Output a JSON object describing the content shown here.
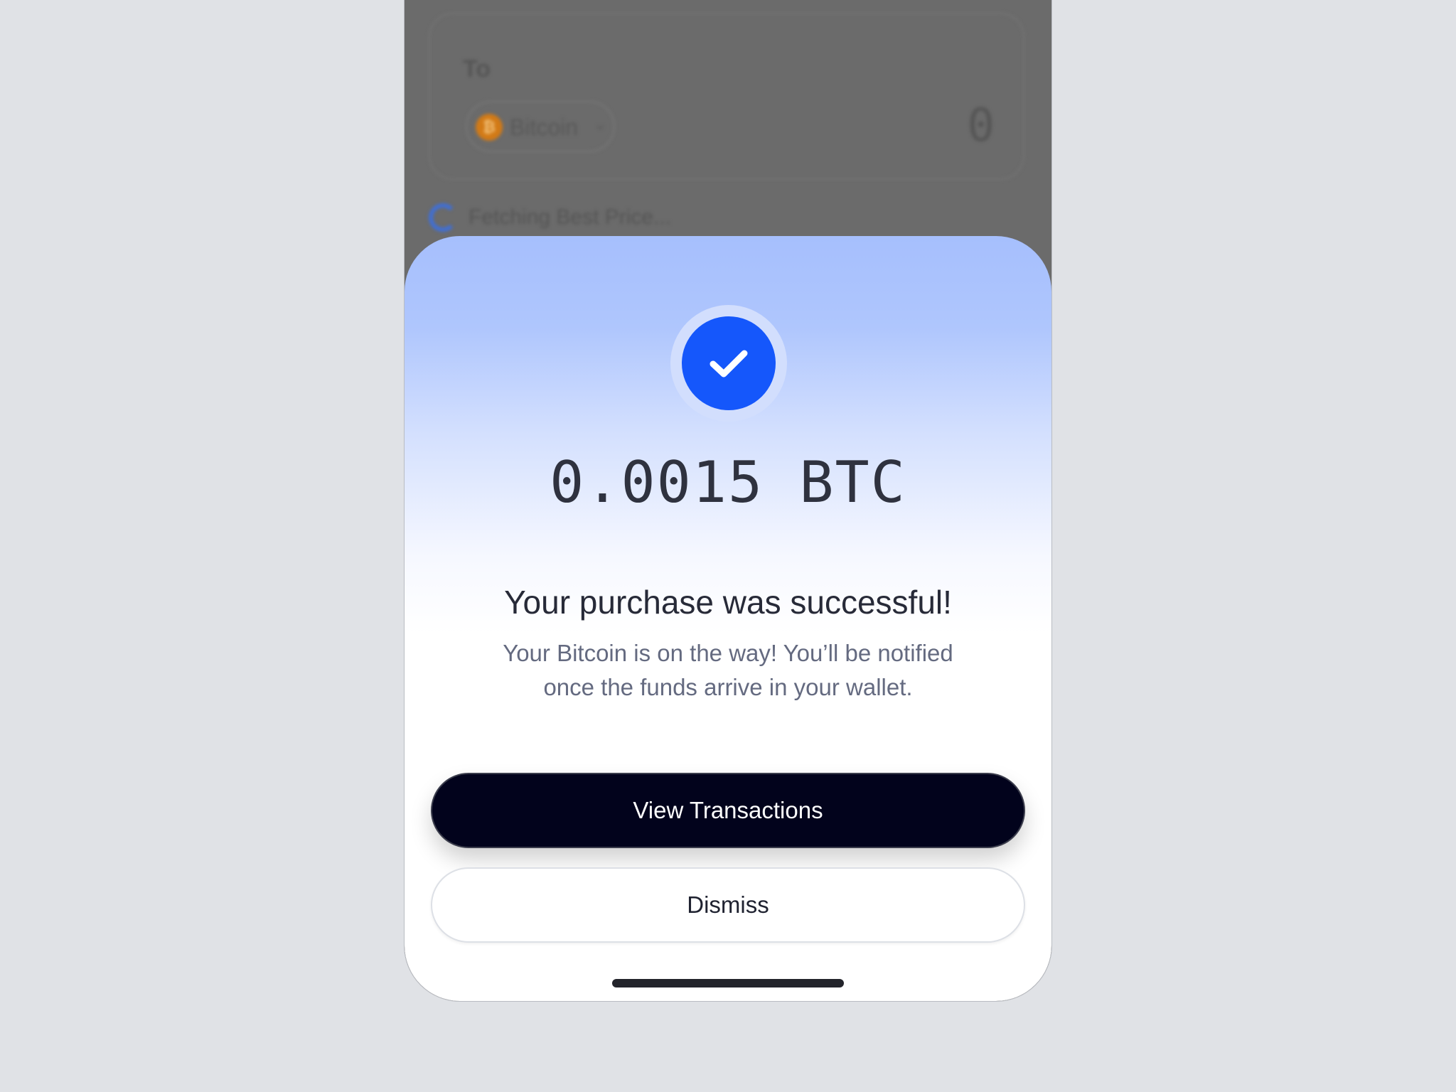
{
  "background_screen": {
    "to_label": "To",
    "coin_icon_glyph": "₿",
    "coin_name": "Bitcoin",
    "chevron_glyph": "⌄",
    "amount_placeholder": "0",
    "fetching_text": "Fetching Best Price..."
  },
  "sheet": {
    "status_icon": "check-circle-icon",
    "amount": "0.0015 BTC",
    "title": "Your purchase was successful!",
    "subtitle": "Your Bitcoin is on the way! You’ll be notified once the funds arrive in your wallet.",
    "primary_button": "View Transactions",
    "secondary_button": "Dismiss"
  },
  "colors": {
    "accent": "#1557fb",
    "primary_button_bg": "#02031c",
    "page_bg": "#e0e2e6"
  }
}
